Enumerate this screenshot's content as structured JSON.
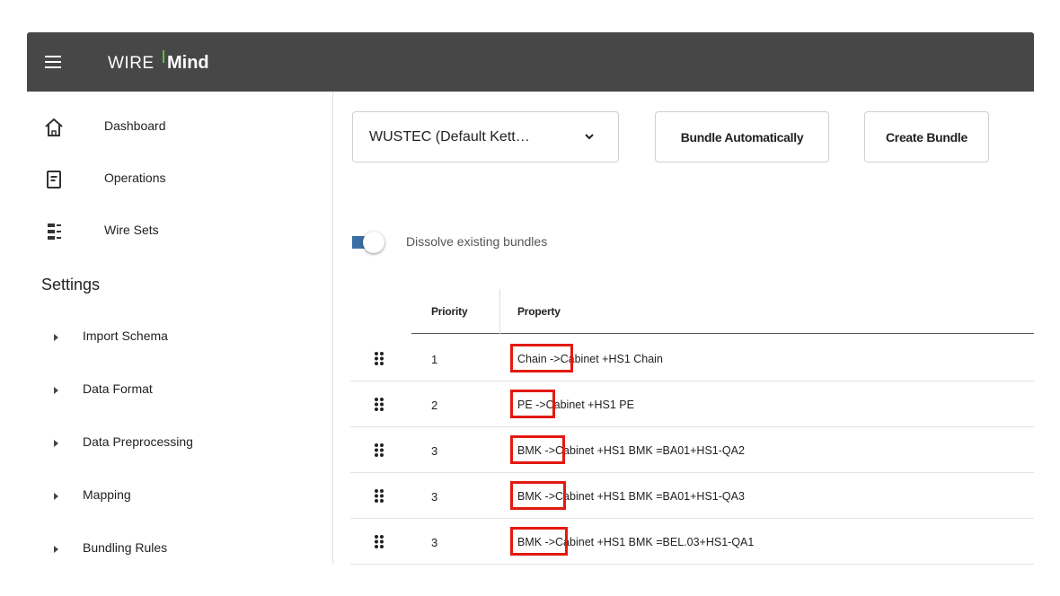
{
  "app": {
    "logo_wire": "WIRE",
    "logo_mind": "Mind",
    "logo_tick_color": "#5fc23a"
  },
  "sidebar": {
    "items": [
      {
        "label": "Dashboard",
        "icon": "home-icon"
      },
      {
        "label": "Operations",
        "icon": "document-icon"
      },
      {
        "label": "Wire Sets",
        "icon": "list-icon"
      }
    ],
    "settings_heading": "Settings",
    "settings_items": [
      {
        "label": "Import Schema"
      },
      {
        "label": "Data Format"
      },
      {
        "label": "Data Preprocessing"
      },
      {
        "label": "Mapping"
      },
      {
        "label": "Bundling Rules"
      }
    ]
  },
  "toolbar": {
    "select_value": "WUSTEC (Default Kett…",
    "bundle_auto_label": "Bundle Automatically",
    "create_bundle_label": "Create Bundle"
  },
  "options": {
    "dissolve_label": "Dissolve existing bundles",
    "dissolve_on": true,
    "toggle_color": "#3a6ea5"
  },
  "table": {
    "headers": {
      "priority": "Priority",
      "property": "Property"
    },
    "rows": [
      {
        "priority": "1",
        "prop_key": "Chain ->",
        "prop_rest": "Cabinet +HS1 Chain"
      },
      {
        "priority": "2",
        "prop_key": "PE ->",
        "prop_rest": "Cabinet +HS1 PE"
      },
      {
        "priority": "3",
        "prop_key": "BMK ->",
        "prop_rest": "Cabinet +HS1 BMK =BA01+HS1-QA2"
      },
      {
        "priority": "3",
        "prop_key": "BMK ->",
        "prop_rest": "Cabinet +HS1 BMK =BA01+HS1-QA3"
      },
      {
        "priority": "3",
        "prop_key": "BMK ->",
        "prop_rest": "Cabinet +HS1 BMK =BEL.03+HS1-QA1"
      }
    ],
    "highlight_color": "#e3190f"
  }
}
